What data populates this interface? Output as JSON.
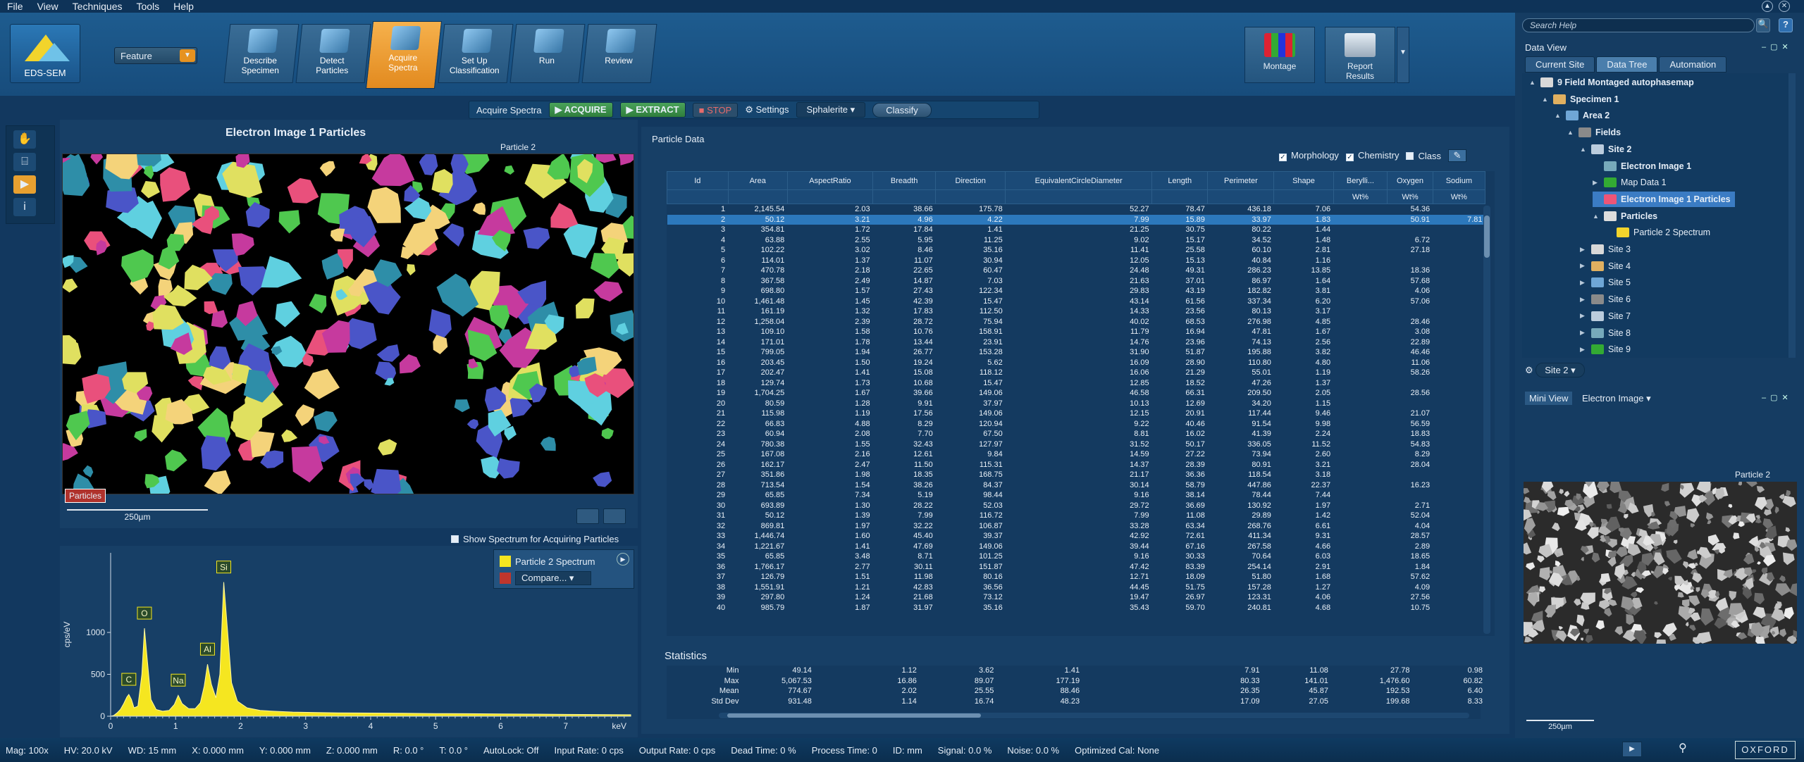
{
  "menu": [
    "File",
    "View",
    "Techniques",
    "Tools",
    "Help"
  ],
  "app": {
    "mode": "EDS-SEM",
    "feature_select": "Feature"
  },
  "workflow": [
    {
      "label": "Describe\nSpecimen"
    },
    {
      "label": "Detect\nParticles"
    },
    {
      "label": "Acquire\nSpectra"
    },
    {
      "label": "Set Up\nClassification"
    },
    {
      "label": "Run"
    },
    {
      "label": "Review"
    }
  ],
  "right_buttons": [
    {
      "label": "Montage"
    },
    {
      "label": "Report\nResults"
    }
  ],
  "acq_bar": {
    "label": "Acquire Spectra",
    "acquire": "ACQUIRE",
    "extract": "EXTRACT",
    "stop": "STOP",
    "settings": "Settings",
    "sphalerite": "Sphalerite",
    "classify": "Classify"
  },
  "image_panel": {
    "title": "Electron Image 1 Particles",
    "particle_label": "Particle 2",
    "tag": "Particles",
    "scale": "250µm",
    "show_spectrum": "Show Spectrum for Acquiring Particles"
  },
  "spectrum": {
    "legend": [
      "Particle 2 Spectrum",
      "Compare..."
    ],
    "colors": {
      "spec": "#f5e620",
      "compare": "#c0362c"
    },
    "chart_data": {
      "type": "area",
      "title": "",
      "xlabel": "keV",
      "ylabel": "cps/eV",
      "xlim": [
        0,
        8
      ],
      "ylim": [
        0,
        1950
      ],
      "x_ticks": [
        "0",
        "1",
        "2",
        "3",
        "4",
        "5",
        "6",
        "7"
      ],
      "y_ticks": [
        "0",
        "500",
        "1000"
      ],
      "peaks": [
        {
          "label": "C",
          "x": 0.28,
          "y": 260
        },
        {
          "label": "O",
          "x": 0.52,
          "y": 1050
        },
        {
          "label": "Na",
          "x": 1.04,
          "y": 250
        },
        {
          "label": "Al",
          "x": 1.49,
          "y": 620
        },
        {
          "label": "Si",
          "x": 1.74,
          "y": 1600
        }
      ],
      "series": [
        {
          "x": [
            0,
            0.05,
            0.1,
            0.15,
            0.2,
            0.25,
            0.28,
            0.32,
            0.36,
            0.42,
            0.48,
            0.52,
            0.56,
            0.62,
            0.7,
            0.8,
            0.9,
            0.98,
            1.04,
            1.1,
            1.2,
            1.3,
            1.38,
            1.44,
            1.49,
            1.55,
            1.62,
            1.68,
            1.74,
            1.8,
            1.86,
            1.95,
            2.1,
            2.3,
            2.5,
            2.8,
            3.1,
            3.5,
            4,
            4.5,
            5,
            5.5,
            6,
            6.5,
            7,
            7.5,
            8
          ],
          "y": [
            0,
            10,
            40,
            80,
            150,
            230,
            260,
            200,
            100,
            120,
            500,
            1050,
            700,
            200,
            80,
            60,
            70,
            140,
            250,
            150,
            90,
            90,
            160,
            360,
            620,
            380,
            220,
            500,
            1600,
            1000,
            400,
            180,
            100,
            70,
            60,
            50,
            45,
            40,
            38,
            35,
            32,
            30,
            28,
            25,
            22,
            20,
            18
          ]
        }
      ]
    }
  },
  "particle_data": {
    "title": "Particle Data",
    "options": [
      "Morphology",
      "Chemistry",
      "Class"
    ],
    "columns": [
      "Id",
      "Area",
      "AspectRatio",
      "Breadth",
      "Direction",
      "EquivalentCircleDiameter",
      "Length",
      "Perimeter",
      "Shape",
      "Berylli...",
      "Oxygen",
      "Sodium"
    ],
    "units": [
      "",
      "",
      "",
      "",
      "",
      "",
      "",
      "",
      "",
      "Wt%",
      "Wt%",
      "Wt%"
    ],
    "rows": [
      [
        "1",
        "2,145.54",
        "2.03",
        "38.66",
        "175.78",
        "52.27",
        "78.47",
        "436.18",
        "7.06",
        "",
        "54.36",
        ""
      ],
      [
        "2",
        "50.12",
        "3.21",
        "4.96",
        "4.22",
        "7.99",
        "15.89",
        "33.97",
        "1.83",
        "",
        "50.91",
        "7.81"
      ],
      [
        "3",
        "354.81",
        "1.72",
        "17.84",
        "1.41",
        "21.25",
        "30.75",
        "80.22",
        "1.44",
        "",
        "",
        ""
      ],
      [
        "4",
        "63.88",
        "2.55",
        "5.95",
        "11.25",
        "9.02",
        "15.17",
        "34.52",
        "1.48",
        "",
        "6.72",
        ""
      ],
      [
        "5",
        "102.22",
        "3.02",
        "8.46",
        "35.16",
        "11.41",
        "25.58",
        "60.10",
        "2.81",
        "",
        "27.18",
        ""
      ],
      [
        "6",
        "114.01",
        "1.37",
        "11.07",
        "30.94",
        "12.05",
        "15.13",
        "40.84",
        "1.16",
        "",
        "",
        ""
      ],
      [
        "7",
        "470.78",
        "2.18",
        "22.65",
        "60.47",
        "24.48",
        "49.31",
        "286.23",
        "13.85",
        "",
        "18.36",
        ""
      ],
      [
        "8",
        "367.58",
        "2.49",
        "14.87",
        "7.03",
        "21.63",
        "37.01",
        "86.97",
        "1.64",
        "",
        "57.68",
        ""
      ],
      [
        "9",
        "698.80",
        "1.57",
        "27.43",
        "122.34",
        "29.83",
        "43.19",
        "182.82",
        "3.81",
        "",
        "4.06",
        ""
      ],
      [
        "10",
        "1,461.48",
        "1.45",
        "42.39",
        "15.47",
        "43.14",
        "61.56",
        "337.34",
        "6.20",
        "",
        "57.06",
        ""
      ],
      [
        "11",
        "161.19",
        "1.32",
        "17.83",
        "112.50",
        "14.33",
        "23.56",
        "80.13",
        "3.17",
        "",
        "",
        ""
      ],
      [
        "12",
        "1,258.04",
        "2.39",
        "28.72",
        "75.94",
        "40.02",
        "68.53",
        "276.98",
        "4.85",
        "",
        "28.46",
        ""
      ],
      [
        "13",
        "109.10",
        "1.58",
        "10.76",
        "158.91",
        "11.79",
        "16.94",
        "47.81",
        "1.67",
        "",
        "3.08",
        ""
      ],
      [
        "14",
        "171.01",
        "1.78",
        "13.44",
        "23.91",
        "14.76",
        "23.96",
        "74.13",
        "2.56",
        "",
        "22.89",
        ""
      ],
      [
        "15",
        "799.05",
        "1.94",
        "26.77",
        "153.28",
        "31.90",
        "51.87",
        "195.88",
        "3.82",
        "",
        "46.46",
        ""
      ],
      [
        "16",
        "203.45",
        "1.50",
        "19.24",
        "5.62",
        "16.09",
        "28.90",
        "110.80",
        "4.80",
        "",
        "11.06",
        ""
      ],
      [
        "17",
        "202.47",
        "1.41",
        "15.08",
        "118.12",
        "16.06",
        "21.29",
        "55.01",
        "1.19",
        "",
        "58.26",
        ""
      ],
      [
        "18",
        "129.74",
        "1.73",
        "10.68",
        "15.47",
        "12.85",
        "18.52",
        "47.26",
        "1.37",
        "",
        "",
        ""
      ],
      [
        "19",
        "1,704.25",
        "1.67",
        "39.66",
        "149.06",
        "46.58",
        "66.31",
        "209.50",
        "2.05",
        "",
        "28.56",
        ""
      ],
      [
        "20",
        "80.59",
        "1.28",
        "9.91",
        "37.97",
        "10.13",
        "12.69",
        "34.20",
        "1.15",
        "",
        "",
        ""
      ],
      [
        "21",
        "115.98",
        "1.19",
        "17.56",
        "149.06",
        "12.15",
        "20.91",
        "117.44",
        "9.46",
        "",
        "21.07",
        ""
      ],
      [
        "22",
        "66.83",
        "4.88",
        "8.29",
        "120.94",
        "9.22",
        "40.46",
        "91.54",
        "9.98",
        "",
        "56.59",
        ""
      ],
      [
        "23",
        "60.94",
        "2.08",
        "7.70",
        "67.50",
        "8.81",
        "16.02",
        "41.39",
        "2.24",
        "",
        "18.83",
        ""
      ],
      [
        "24",
        "780.38",
        "1.55",
        "32.43",
        "127.97",
        "31.52",
        "50.17",
        "336.05",
        "11.52",
        "",
        "54.83",
        ""
      ],
      [
        "25",
        "167.08",
        "2.16",
        "12.61",
        "9.84",
        "14.59",
        "27.22",
        "73.94",
        "2.60",
        "",
        "8.29",
        ""
      ],
      [
        "26",
        "162.17",
        "2.47",
        "11.50",
        "115.31",
        "14.37",
        "28.39",
        "80.91",
        "3.21",
        "",
        "28.04",
        ""
      ],
      [
        "27",
        "351.86",
        "1.98",
        "18.35",
        "168.75",
        "21.17",
        "36.36",
        "118.54",
        "3.18",
        "",
        "",
        ""
      ],
      [
        "28",
        "713.54",
        "1.54",
        "38.26",
        "84.37",
        "30.14",
        "58.79",
        "447.86",
        "22.37",
        "",
        "16.23",
        ""
      ],
      [
        "29",
        "65.85",
        "7.34",
        "5.19",
        "98.44",
        "9.16",
        "38.14",
        "78.44",
        "7.44",
        "",
        "",
        ""
      ],
      [
        "30",
        "693.89",
        "1.30",
        "28.22",
        "52.03",
        "29.72",
        "36.69",
        "130.92",
        "1.97",
        "",
        "2.71",
        ""
      ],
      [
        "31",
        "50.12",
        "1.39",
        "7.99",
        "116.72",
        "7.99",
        "11.08",
        "29.89",
        "1.42",
        "",
        "52.04",
        ""
      ],
      [
        "32",
        "869.81",
        "1.97",
        "32.22",
        "106.87",
        "33.28",
        "63.34",
        "268.76",
        "6.61",
        "",
        "4.04",
        ""
      ],
      [
        "33",
        "1,446.74",
        "1.60",
        "45.40",
        "39.37",
        "42.92",
        "72.61",
        "411.34",
        "9.31",
        "",
        "28.57",
        ""
      ],
      [
        "34",
        "1,221.67",
        "1.41",
        "47.69",
        "149.06",
        "39.44",
        "67.16",
        "267.58",
        "4.66",
        "",
        "2.89",
        ""
      ],
      [
        "35",
        "65.85",
        "3.48",
        "8.71",
        "101.25",
        "9.16",
        "30.33",
        "70.64",
        "6.03",
        "",
        "18.65",
        ""
      ],
      [
        "36",
        "1,766.17",
        "2.77",
        "30.11",
        "151.87",
        "47.42",
        "83.39",
        "254.14",
        "2.91",
        "",
        "1.84",
        ""
      ],
      [
        "37",
        "126.79",
        "1.51",
        "11.98",
        "80.16",
        "12.71",
        "18.09",
        "51.80",
        "1.68",
        "",
        "57.62",
        ""
      ],
      [
        "38",
        "1,551.91",
        "1.21",
        "42.83",
        "36.56",
        "44.45",
        "51.75",
        "157.28",
        "1.27",
        "",
        "4.09",
        ""
      ],
      [
        "39",
        "297.80",
        "1.24",
        "21.68",
        "73.12",
        "19.47",
        "26.97",
        "123.31",
        "4.06",
        "",
        "27.56",
        ""
      ],
      [
        "40",
        "985.79",
        "1.87",
        "31.97",
        "35.16",
        "35.43",
        "59.70",
        "240.81",
        "4.68",
        "",
        "10.75",
        ""
      ]
    ],
    "selected_row": 1
  },
  "statistics": {
    "title": "Statistics",
    "rows": [
      [
        "Min",
        "49.14",
        "1.12",
        "3.62",
        "1.41",
        "7.91",
        "11.08",
        "27.78",
        "0.98"
      ],
      [
        "Max",
        "5,067.53",
        "16.86",
        "89.07",
        "177.19",
        "80.33",
        "141.01",
        "1,476.60",
        "60.82"
      ],
      [
        "Mean",
        "774.67",
        "2.02",
        "25.55",
        "88.46",
        "26.35",
        "45.87",
        "192.53",
        "6.40"
      ],
      [
        "Std Dev",
        "931.48",
        "1.14",
        "16.74",
        "48.23",
        "17.09",
        "27.05",
        "199.68",
        "8.33"
      ]
    ]
  },
  "right_panel": {
    "search_placeholder": "Search Help",
    "data_view": "Data View",
    "tabs": [
      "Current Site",
      "Data Tree",
      "Automation"
    ],
    "tree": [
      {
        "label": "9 Field Montaged autophasemap",
        "level": 0,
        "bold": true,
        "tw": "▲"
      },
      {
        "label": "Specimen 1",
        "level": 1,
        "bold": true,
        "tw": "▲"
      },
      {
        "label": "Area 2",
        "level": 2,
        "bold": true,
        "tw": "▲"
      },
      {
        "label": "Fields",
        "level": 3,
        "bold": true,
        "tw": "▲"
      },
      {
        "label": "Site 2",
        "level": 4,
        "bold": true,
        "tw": "▲"
      },
      {
        "label": "Electron Image 1",
        "level": 5,
        "bold": true,
        "tw": ""
      },
      {
        "label": "Map Data 1",
        "level": 5,
        "bold": false,
        "tw": "▶"
      },
      {
        "label": "Electron Image 1 Particles",
        "level": 5,
        "bold": true,
        "tw": "",
        "sel": true
      },
      {
        "label": "Particles",
        "level": 5,
        "bold": true,
        "tw": "▲"
      },
      {
        "label": "Particle 2 Spectrum",
        "level": 6,
        "bold": false,
        "tw": ""
      },
      {
        "label": "Site 3",
        "level": 4,
        "bold": false,
        "tw": "▶"
      },
      {
        "label": "Site 4",
        "level": 4,
        "bold": false,
        "tw": "▶"
      },
      {
        "label": "Site 5",
        "level": 4,
        "bold": false,
        "tw": "▶"
      },
      {
        "label": "Site 6",
        "level": 4,
        "bold": false,
        "tw": "▶"
      },
      {
        "label": "Site 7",
        "level": 4,
        "bold": false,
        "tw": "▶"
      },
      {
        "label": "Site 8",
        "level": 4,
        "bold": false,
        "tw": "▶"
      },
      {
        "label": "Site 9",
        "level": 4,
        "bold": false,
        "tw": "▶"
      }
    ],
    "site_select": "Site 2",
    "mini_view": "Mini View",
    "mini_select": "Electron Image",
    "mini_particle_label": "Particle 2",
    "mini_scale": "250µm"
  },
  "status": [
    "Mag: 100x",
    "HV: 20.0 kV",
    "WD: 15 mm",
    "X: 0.000 mm",
    "Y: 0.000 mm",
    "Z: 0.000 mm",
    "R: 0.0 °",
    "T: 0.0 °",
    "AutoLock: Off",
    "Input Rate: 0 cps",
    "Output Rate: 0 cps",
    "Dead Time: 0 %",
    "Process Time: 0",
    "ID: mm",
    "Signal: 0.0 %",
    "Noise: 0.0 %",
    "Optimized Cal: None"
  ],
  "logo": "OXFORD"
}
